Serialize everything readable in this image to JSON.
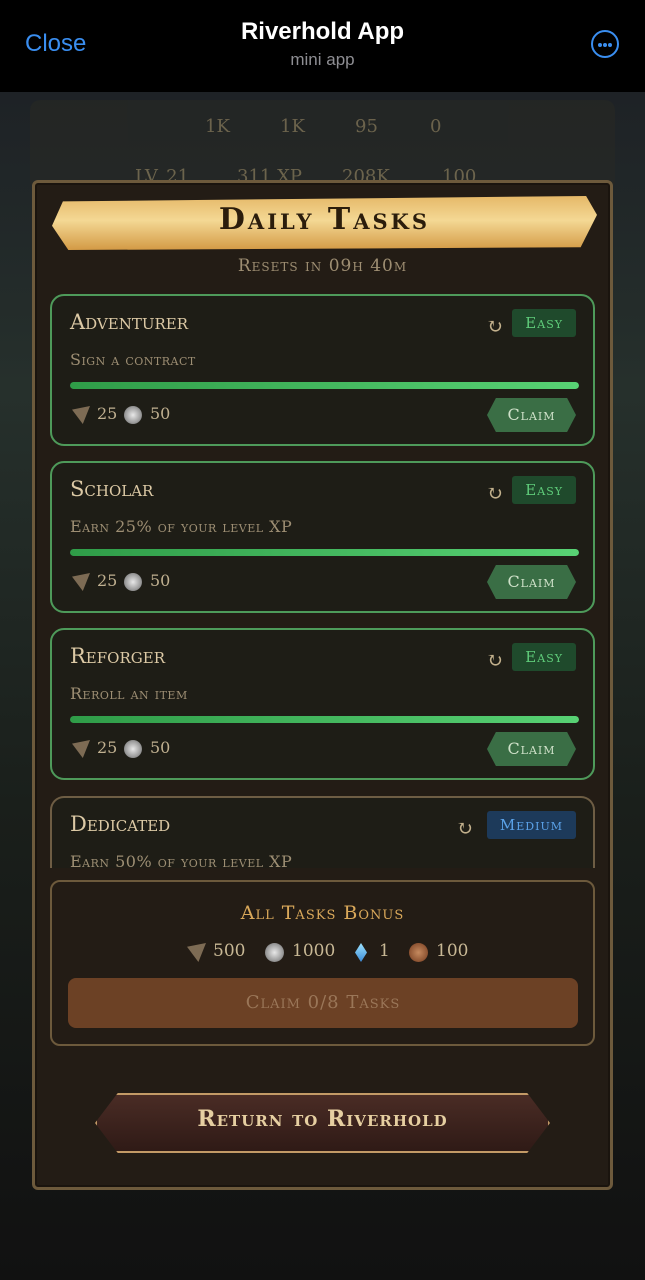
{
  "header": {
    "close_label": "Close",
    "title": "Riverhold App",
    "subtitle": "mini app"
  },
  "hud": {
    "level": "LV. 21",
    "xp": "311 XP",
    "stat1": "1K",
    "stat2": "1K",
    "stat3": "95",
    "stat4": "0",
    "stat5": "208K",
    "stat6": "100"
  },
  "panel": {
    "title": "Daily Tasks",
    "resets": "Resets in 09h 40m"
  },
  "tasks": [
    {
      "name": "Adventurer",
      "description": "Sign a contract",
      "difficulty": "Easy",
      "progress": 1.0,
      "reward_wood": "25",
      "reward_silver": "50",
      "claim_label": "Claim"
    },
    {
      "name": "Scholar",
      "description": "Earn 25% of your level XP",
      "difficulty": "Easy",
      "progress": 1.0,
      "reward_wood": "25",
      "reward_silver": "50",
      "claim_label": "Claim"
    },
    {
      "name": "Reforger",
      "description": "Reroll an item",
      "difficulty": "Easy",
      "progress": 1.0,
      "reward_wood": "25",
      "reward_silver": "50",
      "claim_label": "Claim"
    },
    {
      "name": "Dedicated",
      "description": "Earn 50% of your level XP",
      "difficulty": "Medium"
    }
  ],
  "bonus": {
    "title": "All Tasks Bonus",
    "wood": "500",
    "silver": "1000",
    "crystal": "1",
    "copper": "100",
    "claim_label": "Claim 0/8 Tasks"
  },
  "return_label": "Return to Riverhold",
  "colors": {
    "accent_green": "#4e9a5a",
    "banner_gold": "#f4d894",
    "ios_blue": "#3a8ef0"
  }
}
